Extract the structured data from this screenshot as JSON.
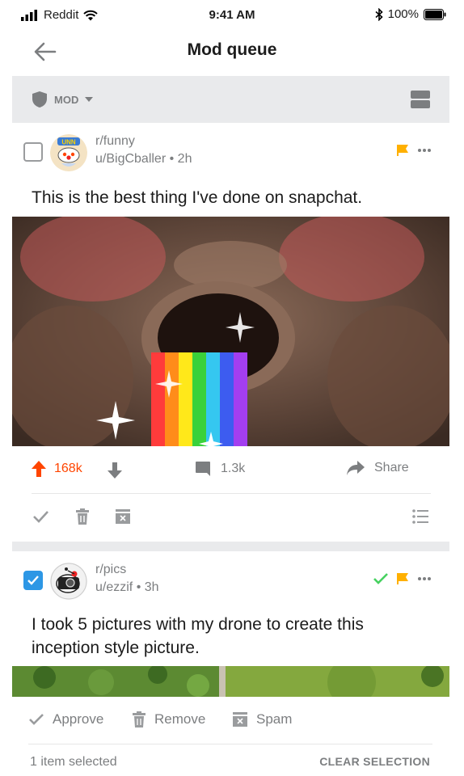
{
  "status_bar": {
    "carrier": "Reddit",
    "time": "9:41 AM",
    "battery": "100%"
  },
  "header": {
    "title": "Mod queue"
  },
  "mod_bar": {
    "dropdown_label": "MOD"
  },
  "posts": [
    {
      "subreddit": "r/funny",
      "user": "u/BigCballer",
      "age": "2h",
      "title": "This is the best thing I've done on snapchat.",
      "upvotes": "168k",
      "comments": "1.3k",
      "share_label": "Share",
      "selected": false,
      "flagged": true,
      "approved": false
    },
    {
      "subreddit": "r/pics",
      "user": "u/ezzif",
      "age": "3h",
      "title": "I took 5 pictures with my drone to create this inception style picture.",
      "selected": true,
      "flagged": true,
      "approved": true
    }
  ],
  "bottom_bar": {
    "approve_label": "Approve",
    "remove_label": "Remove",
    "spam_label": "Spam",
    "selected_count": "1 item selected",
    "clear_label": "CLEAR SELECTION"
  },
  "colors": {
    "accent_upvote": "#ff4500",
    "checkbox_selected": "#2d97e5",
    "flag": "#ffb000",
    "approve_green": "#46d160",
    "icon_gray": "#7c7e80",
    "band_gray": "#e9eaec"
  },
  "separator": "•"
}
